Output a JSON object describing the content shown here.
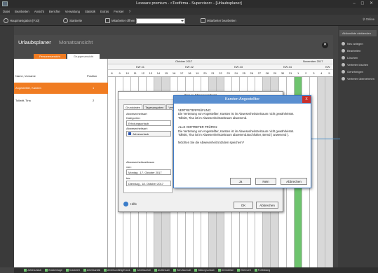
{
  "window": {
    "title": "Lexware premium - <Testfirma - Supervisor> - [Urlaubsplaner]"
  },
  "menu": [
    "Datei",
    "Bearbeiten",
    "Ansicht",
    "Berichte",
    "Verwaltung",
    "Statistik",
    "Extras",
    "Fenster",
    "?"
  ],
  "toolbar": {
    "nav_label": "Hauptnavigation [F10]",
    "start_label": "Startseite",
    "open_label": "Mitarbeiter öffnen",
    "edit_label": "Mitarbeiter bearbeiten",
    "online_label": "Online"
  },
  "page": {
    "title": "Urlaubsplaner",
    "subtitle": "Monatsansicht",
    "tab_person": "Personenansicht",
    "tab_group": "Gruppenansicht"
  },
  "grid": {
    "col_name": "Name, Vorname",
    "col_pos": "Position",
    "months": [
      "Oktober 2017",
      "November 2017"
    ],
    "weeks": [
      "KW 41",
      "KW 42",
      "KW 43",
      "KW 44",
      "KW 45"
    ],
    "days": [
      "8",
      "9",
      "10",
      "11",
      "12",
      "13",
      "14",
      "15",
      "16",
      "17",
      "18",
      "19",
      "20",
      "21",
      "22",
      "23",
      "24",
      "25",
      "26",
      "27",
      "28",
      "29",
      "30",
      "31",
      "1",
      "2",
      "3",
      "4",
      "5"
    ],
    "employees": [
      {
        "name": "Angestellter, Karsten",
        "pos": "1"
      },
      {
        "name": "Tollwitt, Tina",
        "pos": "2"
      }
    ]
  },
  "right_panel": {
    "header": "Aktionsliste einblenden",
    "items": [
      "Neu anlegen",
      "Bearbeiten",
      "Löschen",
      "Vertreter löschen",
      "Genehmigen",
      "Vertreter übernehmen"
    ]
  },
  "legend": [
    "Jahresurlaub",
    "Brückentage",
    "Krankheit",
    "Arbeitsunfall",
    "Arbeitsunfähig/Krank",
    "Arbeitsunfall",
    "Arztbesuch",
    "Berufsschule",
    "Bildungsurlaub",
    "Dienstreise",
    "Elternzeit",
    "Fortbildung"
  ],
  "dialog_new": {
    "title": "Neue Abwesenheit",
    "tabs": [
      "Grunddaten",
      "Tagesangaben",
      "Vertreter"
    ],
    "group_abs": "Abwesenheitsart",
    "lbl_cat": "Kategorien:",
    "cat_value": "Erholungsurlaub",
    "lbl_type": "Abwesenheitsart:",
    "type_value": "Jahresurlaub",
    "group_period": "Abwesenheitszeitraum",
    "lbl_from": "von:",
    "from_value": "Montag , 17. Oktober 2017",
    "lbl_to": "bis:",
    "to_value": "Dienstag , 18. Oktober 2017",
    "help": "Hilfe",
    "ok": "OK",
    "cancel": "Abbrechen"
  },
  "dialog_msg": {
    "title": "Karsten Angestellter",
    "close": "X",
    "p1_head": "VERTRETERPRÜFUNG:",
    "p1_body": "Die Vertretung von Angestellter, Karsten ist im  Abwesenheitszeitraum nicht gewährleistet.",
    "p1_body2": "Tollwitt, Tina ist im Abwesenheitszeitraum abwesend.",
    "p2_head": "ALLE VERTRETER PRÜFEN:",
    "p2_body": "Die Vertretung von Angestellter, Karsten ist im  Abwesenheitszeitraum nicht gewährleistet.",
    "p2_body2": "Tollwitt, Tina ist im Abwesenheitszeitraum abwesend.Buchhalter, Bernd ( anwesend ).",
    "question": "Möchten Sie die Abwesenheit trotzdem speichern?",
    "btn_yes": "Ja",
    "btn_no": "Nein",
    "btn_cancel": "Abbrechen"
  }
}
